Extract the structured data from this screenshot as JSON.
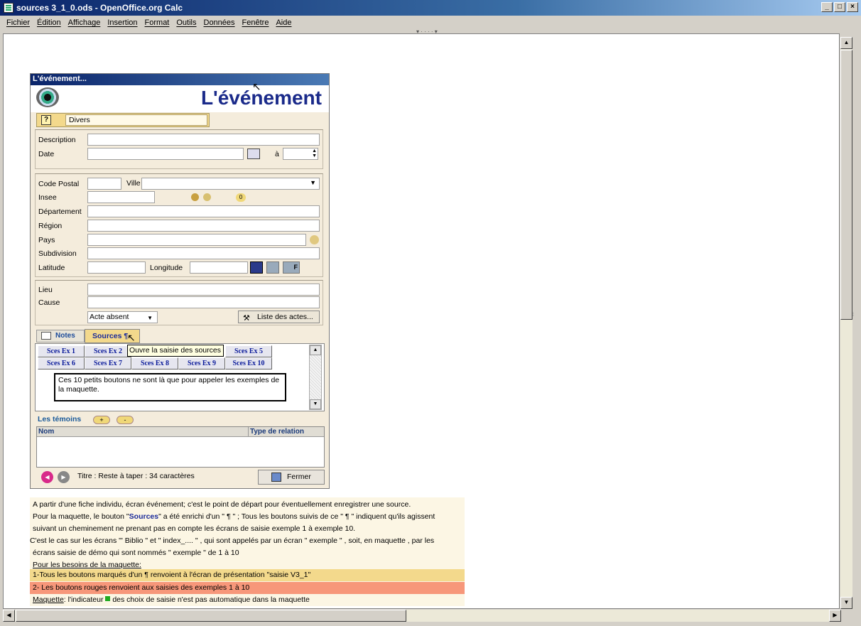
{
  "window": {
    "title": "sources 3_1_0.ods - OpenOffice.org Calc",
    "buttons": [
      "_",
      "□",
      "×"
    ]
  },
  "menu": [
    "Fichier",
    "Édition",
    "Affichage",
    "Insertion",
    "Format",
    "Outils",
    "Données",
    "Fenêtre",
    "Aide"
  ],
  "dialog": {
    "title": "L'événement...",
    "banner_title": "L'événement",
    "category": "Divers",
    "labels": {
      "description": "Description",
      "date": "Date",
      "a": "à",
      "code_postal": "Code Postal",
      "ville": "Ville",
      "insee": "Insee",
      "departement": "Département",
      "region": "Région",
      "pays": "Pays",
      "subdivision": "Subdivision",
      "latitude": "Latitude",
      "longitude": "Longitude",
      "lieu": "Lieu",
      "cause": "Cause"
    },
    "acte_select": "Acte absent",
    "liste_actes": "Liste des actes...",
    "tabs": {
      "notes": "Notes",
      "sources": "Sources ¶"
    },
    "tooltip": "Ouvre la saisie des sources",
    "sces_buttons": [
      "Sces Ex 1",
      "Sces Ex 2",
      "Sces Ex 5",
      "Sces Ex 6",
      "Sces Ex 7",
      "Sces Ex 8",
      "Sces Ex 9",
      "Sces Ex 10"
    ],
    "note_box": "Ces 10 petits boutons ne sont là que pour appeler les exemples de la maquette.",
    "temoins": "Les témoins",
    "plus": "+",
    "minus": "-",
    "col_nom": "Nom",
    "col_type": "Type de relation",
    "titre_status": "Titre : Reste à taper : 34 caractères",
    "fermer": "Fermer"
  },
  "notes": {
    "line1": "A partir d'une fiche individu, écran événement; c'est le point de départ pour éventuellement enregistrer une source.",
    "line2a": "Pour la maquette, le bouton \"",
    "line2b": "Sources",
    "line2c": "\" a été enrichi d'un \" ¶ \" ; Tous les boutons suivis de ce \" ¶ \" indiquent qu'ils agissent",
    "line3": "suivant un cheminement ne prenant pas en compte les écrans de saisie exemple 1 à exemple 10.",
    "line4": "C'est le cas sur les écrans \"' Biblio \" et \" index_.... \" , qui sont appelés par un écran \" exemple \" , soit, en maquette , par les",
    "line5": "écrans saisie de démo qui sont nommés \" exemple \" de 1 à 10",
    "line6": "Pour les besoins de la maquette:",
    "line7": "1-Tous les boutons marqués d'un ¶ renvoient à l'écran de présentation \"saisie V3_1\"",
    "line8": "2- Les boutons rouges renvoient aux saisies des exemples 1 à 10",
    "line9a": "Maquette",
    "line9b": ": l'indicateur",
    "line9c": "des choix de saisie n'est pas automatique dans la maquette"
  },
  "colors": {
    "line7_bg": "#f3d98c",
    "line8_bg": "#f7977a",
    "indicator": "#22aa22"
  }
}
